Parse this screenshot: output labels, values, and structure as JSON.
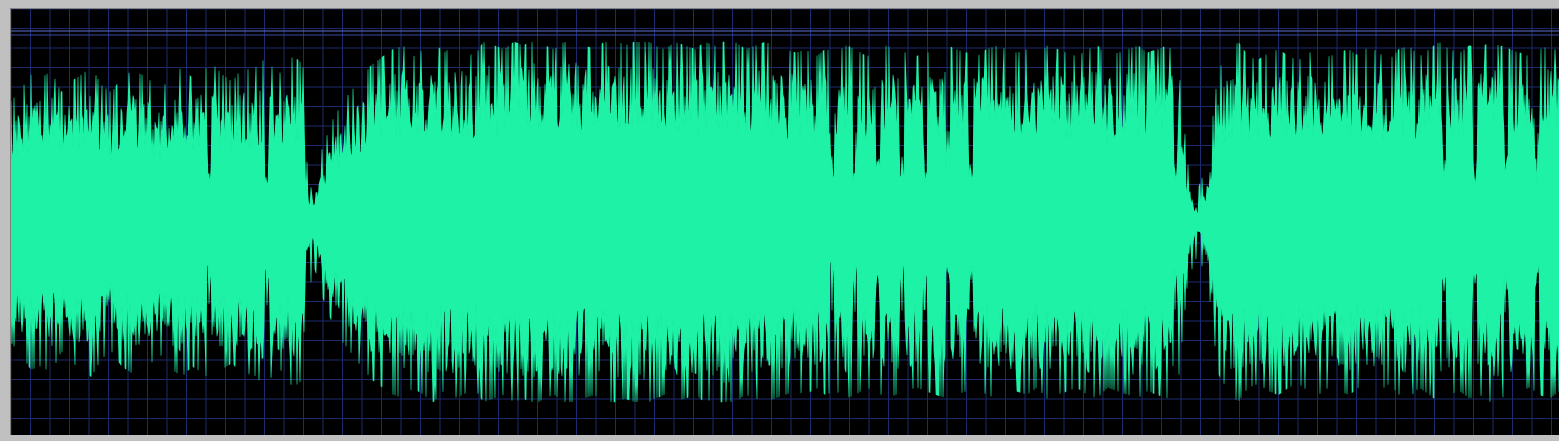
{
  "colors": {
    "background": "#000000",
    "grid": "#1e2a6e",
    "waveform": "#1ef2a6",
    "frame": "#c0c0c0",
    "marker": "#5a6fd0"
  },
  "waveform": {
    "channel_count": 1,
    "grid": true,
    "amplitude_envelope": [
      0.55,
      0.62,
      0.7,
      0.68,
      0.72,
      0.6,
      0.66,
      0.7,
      0.74,
      0.64,
      0.6,
      0.68,
      0.72,
      0.7,
      0.66,
      0.62,
      0.7,
      0.74,
      0.68,
      0.72,
      0.76,
      0.7,
      0.66,
      0.74,
      0.72,
      0.78,
      0.74,
      0.7,
      0.8,
      0.76,
      0.1,
      0.3,
      0.45,
      0.55,
      0.62,
      0.7,
      0.76,
      0.8,
      0.84,
      0.86,
      0.8,
      0.84,
      0.88,
      0.82,
      0.86,
      0.84,
      0.8,
      0.88,
      0.86,
      0.84,
      0.88,
      0.86,
      0.9,
      0.86,
      0.84,
      0.88,
      0.9,
      0.86,
      0.84,
      0.88,
      0.9,
      0.86,
      0.88,
      0.9,
      0.86,
      0.84,
      0.88,
      0.86,
      0.84,
      0.88,
      0.86,
      0.9,
      0.88,
      0.84,
      0.86,
      0.88,
      0.86,
      0.84,
      0.82,
      0.84,
      0.8,
      0.84,
      0.82,
      0.86,
      0.84,
      0.8,
      0.82,
      0.86,
      0.84,
      0.82,
      0.8,
      0.82,
      0.84,
      0.86,
      0.84,
      0.82,
      0.8,
      0.84,
      0.86,
      0.84,
      0.82,
      0.84,
      0.8,
      0.86,
      0.84,
      0.82,
      0.8,
      0.84,
      0.86,
      0.8,
      0.82,
      0.84,
      0.86,
      0.82,
      0.84,
      0.86,
      0.8,
      0.2,
      0.06,
      0.22,
      0.72,
      0.82,
      0.88,
      0.8,
      0.78,
      0.82,
      0.84,
      0.8,
      0.78,
      0.82,
      0.84,
      0.8,
      0.82,
      0.84,
      0.8,
      0.86,
      0.82,
      0.78,
      0.84,
      0.86,
      0.8,
      0.84,
      0.88,
      0.84,
      0.82,
      0.86,
      0.84,
      0.88,
      0.86,
      0.84,
      0.82,
      0.8,
      0.84,
      0.86,
      0.82
    ],
    "dropouts": [
      0.128,
      0.165,
      0.192,
      0.53,
      0.545,
      0.56,
      0.575,
      0.59,
      0.605,
      0.62,
      0.752,
      0.925,
      0.945,
      0.965,
      0.985
    ]
  }
}
